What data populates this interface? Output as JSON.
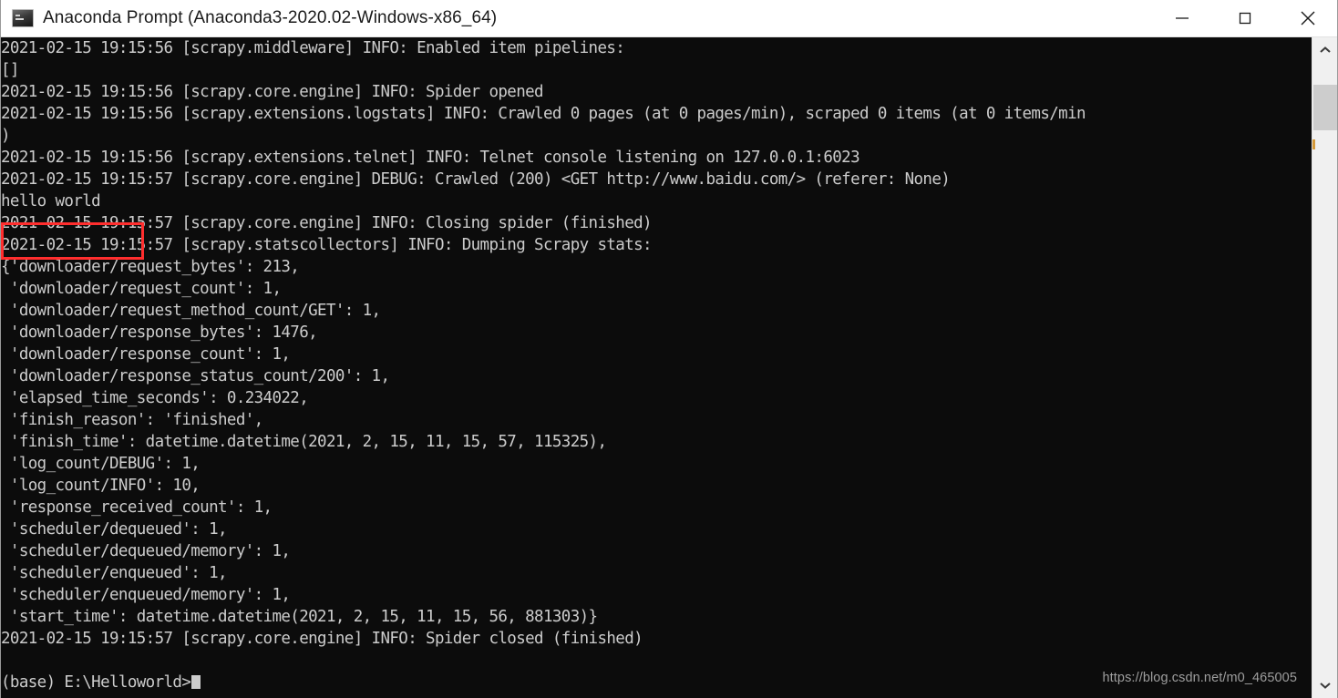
{
  "window": {
    "title": "Anaconda Prompt (Anaconda3-2020.02-Windows-x86_64)",
    "icon": "console-icon",
    "controls": {
      "minimize_label": "Minimize",
      "maximize_label": "Maximize",
      "close_label": "Close"
    }
  },
  "console": {
    "background_color": "#0c0c0c",
    "foreground_color": "#cccccc",
    "lines": [
      "2021-02-15 19:15:56 [scrapy.middleware] INFO: Enabled item pipelines:",
      "[]",
      "2021-02-15 19:15:56 [scrapy.core.engine] INFO: Spider opened",
      "2021-02-15 19:15:56 [scrapy.extensions.logstats] INFO: Crawled 0 pages (at 0 pages/min), scraped 0 items (at 0 items/min",
      ")",
      "2021-02-15 19:15:56 [scrapy.extensions.telnet] INFO: Telnet console listening on 127.0.0.1:6023",
      "2021-02-15 19:15:57 [scrapy.core.engine] DEBUG: Crawled (200) <GET http://www.baidu.com/> (referer: None)",
      "hello world",
      "2021-02-15 19:15:57 [scrapy.core.engine] INFO: Closing spider (finished)",
      "2021-02-15 19:15:57 [scrapy.statscollectors] INFO: Dumping Scrapy stats:",
      "{'downloader/request_bytes': 213,",
      " 'downloader/request_count': 1,",
      " 'downloader/request_method_count/GET': 1,",
      " 'downloader/response_bytes': 1476,",
      " 'downloader/response_count': 1,",
      " 'downloader/response_status_count/200': 1,",
      " 'elapsed_time_seconds': 0.234022,",
      " 'finish_reason': 'finished',",
      " 'finish_time': datetime.datetime(2021, 2, 15, 11, 15, 57, 115325),",
      " 'log_count/DEBUG': 1,",
      " 'log_count/INFO': 10,",
      " 'response_received_count': 1,",
      " 'scheduler/dequeued': 1,",
      " 'scheduler/dequeued/memory': 1,",
      " 'scheduler/enqueued': 1,",
      " 'scheduler/enqueued/memory': 1,",
      " 'start_time': datetime.datetime(2021, 2, 15, 11, 15, 56, 881303)}",
      "2021-02-15 19:15:57 [scrapy.core.engine] INFO: Spider closed (finished)",
      ""
    ],
    "prompt": "(base) E:\\Helloworld>"
  },
  "annotation": {
    "highlight_text": "hello world",
    "color": "#ff2e2e"
  },
  "watermark": {
    "text": "https://blog.csdn.net/m0_465005"
  },
  "scrollbar": {
    "up_arrow": "chevron-up-icon",
    "down_arrow": "chevron-down-icon"
  }
}
